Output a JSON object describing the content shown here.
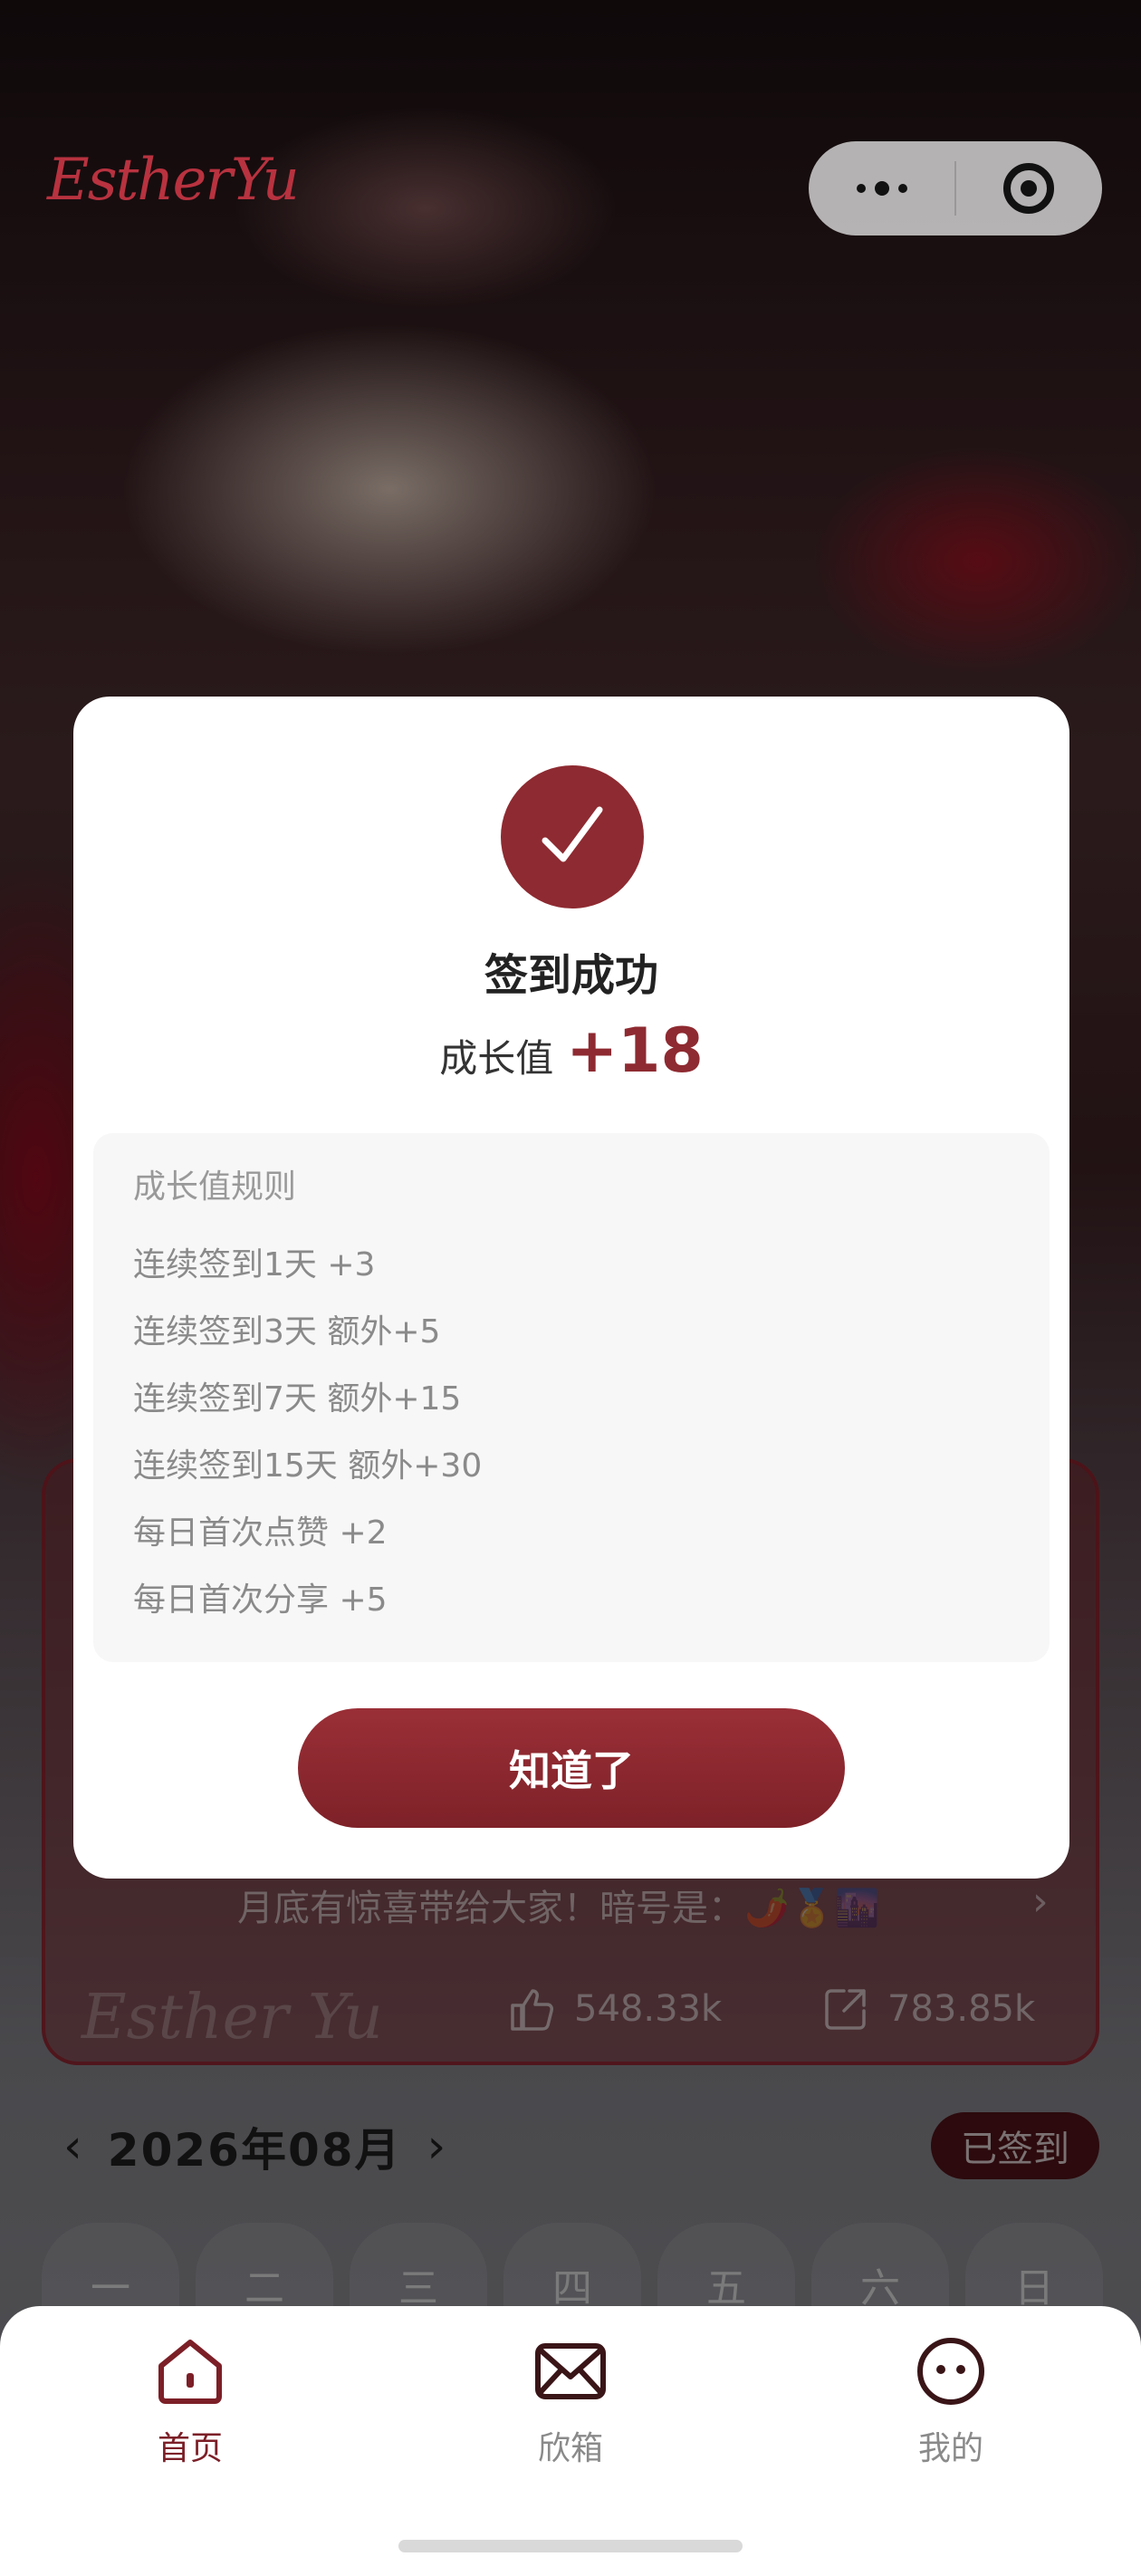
{
  "brand": "EstherYu",
  "post": {
    "text": "月底有惊喜带给大家！暗号是：🌶️🏅🌆",
    "signature": "Esther Yu",
    "likes": "548.33k",
    "shares": "783.85k"
  },
  "calendar": {
    "month": "2026年08月",
    "signed_label": "已签到",
    "weekdays": [
      "一",
      "二",
      "三",
      "四",
      "五",
      "六",
      "日"
    ]
  },
  "modal": {
    "title": "签到成功",
    "growth_label": "成长值",
    "growth_value": "+18",
    "rules_title": "成长值规则",
    "rules": [
      "连续签到1天 +3",
      "连续签到3天 额外+5",
      "连续签到7天 额外+15",
      "连续签到15天 额外+30",
      "每日首次点赞 +2",
      "每日首次分享 +5"
    ],
    "button": "知道了"
  },
  "tabs": [
    {
      "label": "首页",
      "icon": "home-icon",
      "active": true
    },
    {
      "label": "欣箱",
      "icon": "mail-icon",
      "active": false
    },
    {
      "label": "我的",
      "icon": "profile-face-icon",
      "active": false
    }
  ],
  "colors": {
    "accent": "#8e2a31",
    "active_tab": "#7c1f27",
    "inactive_tab": "#8a8a8a"
  }
}
